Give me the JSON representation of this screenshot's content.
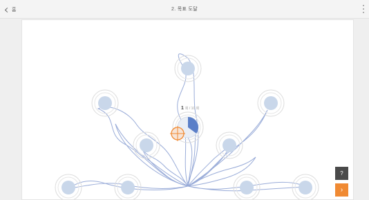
{
  "header": {
    "home_label": "홈",
    "title": "2. 목표 도달"
  },
  "score": {
    "value": "1",
    "unit": "회 / 10 회"
  },
  "hint_button": {
    "label": "?"
  },
  "next_button": {
    "label": "›"
  },
  "progress_fraction": 0.35,
  "targets_count": 9,
  "colors": {
    "target_fill": "#c9d7ea",
    "ring": "#dcdcdc",
    "path": "#8ea3d4",
    "progress": "#5b7fc8",
    "cursor": "#f08a33",
    "next": "#f08a33",
    "hint": "#4a4a4a"
  },
  "icons": {
    "back": "chevron-left-icon",
    "menu": "kebab-menu-icon",
    "cursor": "crosshair-icon"
  }
}
